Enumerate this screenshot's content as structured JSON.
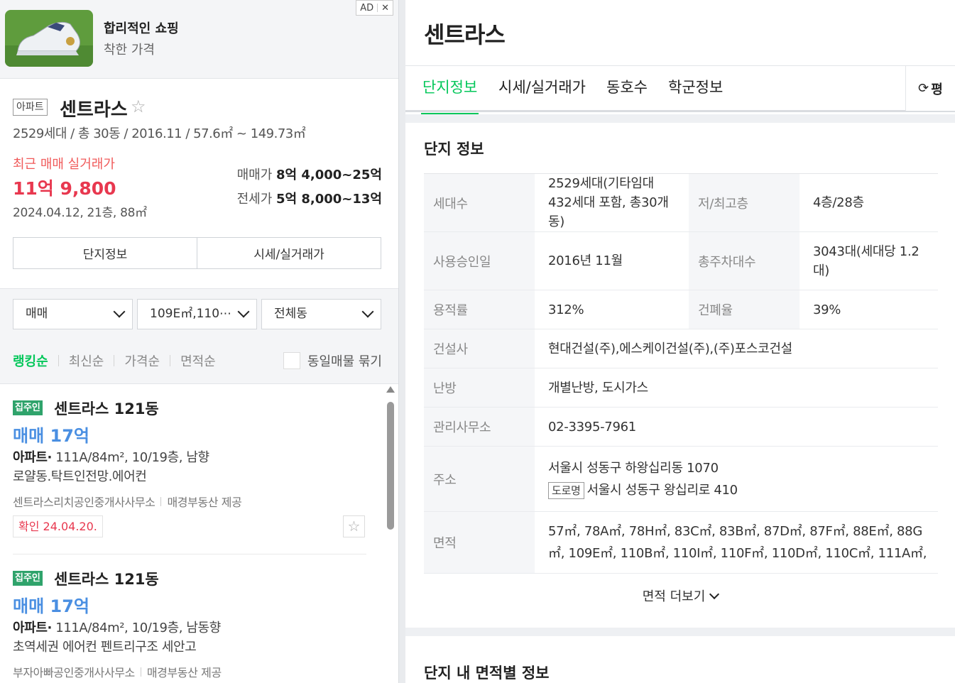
{
  "ad": {
    "badge_label": "AD",
    "close_label": "✕",
    "title": "합리적인 쇼핑",
    "subtitle": "착한 가격"
  },
  "complex": {
    "type_badge": "아파트",
    "name": "센트라스",
    "summary": "2529세대 / 총 30동 / 2016.11 / 57.6㎡ ~ 149.73㎡",
    "recent_label": "최근 매매 실거래가",
    "recent_price": "11억 9,800",
    "recent_detail": "2024.04.12, 21층, 88㎡",
    "sale_label": "매매가",
    "sale_range": "8억 4,000~25억",
    "jeonse_label": "전세가",
    "jeonse_range": "5억 8,000~13억",
    "buttons": [
      "단지정보",
      "시세/실거래가"
    ]
  },
  "filters": {
    "trade_type": "매매",
    "area": "109E㎡,110⋯",
    "dong": "전체동",
    "sort_options": [
      "랭킹순",
      "최신순",
      "가격순",
      "면적순"
    ],
    "active_sort": 0,
    "group_label": "동일매물 묶기"
  },
  "listings": [
    {
      "tag": "집주인",
      "title": "센트라스 121동",
      "price": "매매 17억",
      "type": "아파트",
      "spec": "111A/84m², 10/19층, 남향",
      "desc": "로얄동.탁트인전망.에어컨",
      "agency": "센트라스리치공인중개사사무소",
      "provider": "매경부동산 제공",
      "confirm": "확인 24.04.20."
    },
    {
      "tag": "집주인",
      "title": "센트라스 121동",
      "price": "매매 17억",
      "type": "아파트",
      "spec": "111A/84m², 10/19층, 남동향",
      "desc": "초역세권 에어컨 펜트리구조 세안고",
      "agency": "부자아빠공인중개사사무소",
      "provider": "매경부동산 제공"
    }
  ],
  "detail": {
    "title": "센트라스",
    "tabs": [
      "단지정보",
      "시세/실거래가",
      "동호수",
      "학군정보"
    ],
    "active_tab": 0,
    "unit_toggle": "평",
    "section_title": "단지 정보",
    "info": {
      "households_label": "세대수",
      "households": "2529세대(기타임대 432세대 포함, 총30개동)",
      "floors_label": "저/최고층",
      "floors": "4층/28층",
      "approval_label": "사용승인일",
      "approval": "2016년 11월",
      "parking_label": "총주차대수",
      "parking": "3043대(세대당 1.2대)",
      "far_label": "용적률",
      "far": "312%",
      "bcr_label": "건폐율",
      "bcr": "39%",
      "builder_label": "건설사",
      "builder": "현대건설(주),에스케이건설(주),(주)포스코건설",
      "heating_label": "난방",
      "heating": "개별난방, 도시가스",
      "office_label": "관리사무소",
      "office": "02-3395-7961",
      "address_label": "주소",
      "address_lot": "서울시 성동구 하왕십리동 1070",
      "road_badge": "도로명",
      "address_road": "서울시 성동구 왕십리로 410",
      "area_label": "면적",
      "areas": "57㎡, 78A㎡, 78H㎡, 83C㎡, 83B㎡, 87D㎡, 87F㎡, 88E㎡, 88G㎡, 109E㎡, 110B㎡, 110I㎡, 110F㎡, 110D㎡, 110C㎡, 111A㎡,"
    },
    "more_label": "면적 더보기",
    "area_section_title": "단지 내 면적별 정보"
  },
  "colors": {
    "accent_green": "#03c75a",
    "price_red": "#e8384f",
    "listing_price_blue": "#4a8fe2"
  }
}
